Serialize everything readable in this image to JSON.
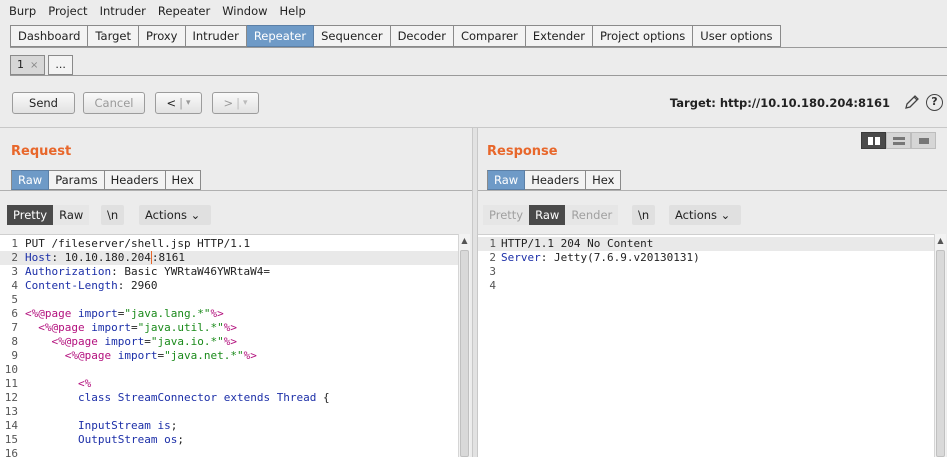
{
  "menu": [
    "Burp",
    "Project",
    "Intruder",
    "Repeater",
    "Window",
    "Help"
  ],
  "main_tabs": [
    {
      "label": "Dashboard",
      "active": false
    },
    {
      "label": "Target",
      "active": false
    },
    {
      "label": "Proxy",
      "active": false
    },
    {
      "label": "Intruder",
      "active": false
    },
    {
      "label": "Repeater",
      "active": true
    },
    {
      "label": "Sequencer",
      "active": false
    },
    {
      "label": "Decoder",
      "active": false
    },
    {
      "label": "Comparer",
      "active": false
    },
    {
      "label": "Extender",
      "active": false
    },
    {
      "label": "Project options",
      "active": false
    },
    {
      "label": "User options",
      "active": false
    }
  ],
  "repeater_tabs": {
    "tab1": "1",
    "close": "×",
    "more": "..."
  },
  "toolbar": {
    "send": "Send",
    "cancel": "Cancel",
    "back": "<",
    "forward": ">",
    "dropdown": "▾",
    "target": "Target: http://10.10.180.204:8161"
  },
  "request": {
    "title": "Request",
    "tabs": [
      "Raw",
      "Params",
      "Headers",
      "Hex"
    ],
    "view": {
      "pretty": "Pretty",
      "raw": "Raw",
      "newline": "\\n",
      "actions": "Actions ⌄"
    },
    "line_numbers": [
      "1",
      "2",
      "3",
      "4",
      "5",
      "6",
      "7",
      "8",
      "9",
      "10",
      "11",
      "12",
      "13",
      "14",
      "15",
      "16"
    ]
  },
  "response": {
    "title": "Response",
    "tabs": [
      "Raw",
      "Headers",
      "Hex"
    ],
    "view": {
      "pretty": "Pretty",
      "raw": "Raw",
      "render": "Render",
      "newline": "\\n",
      "actions": "Actions ⌄"
    },
    "line_numbers": [
      "1",
      "2",
      "3",
      "4"
    ]
  },
  "colors": {
    "accent": "#e8672b",
    "tab_active": "#6e9ac7"
  }
}
